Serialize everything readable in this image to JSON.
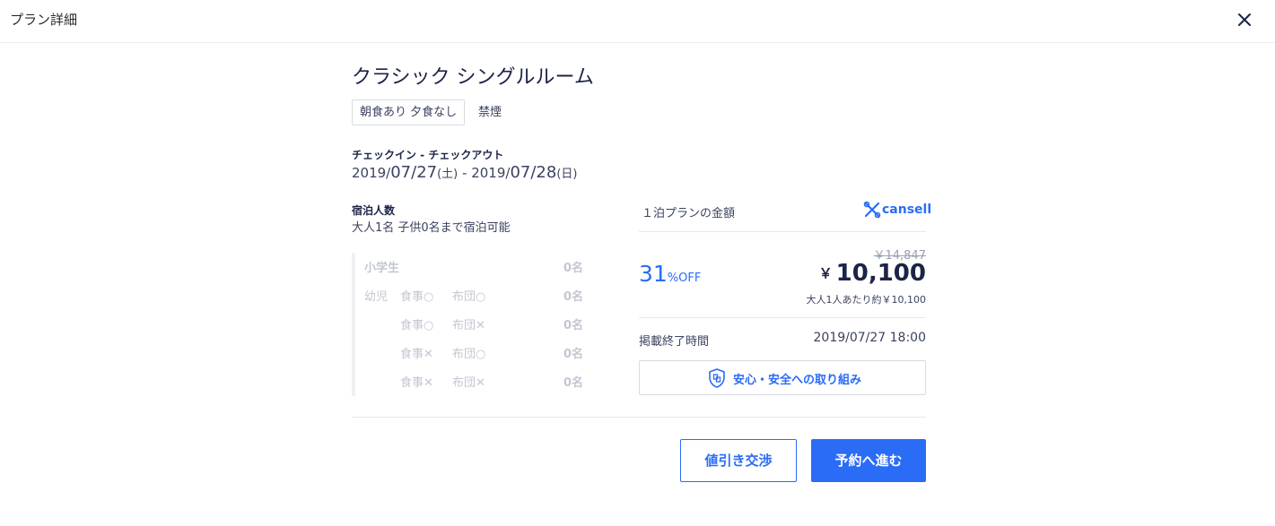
{
  "header": {
    "title": "プラン詳細",
    "close_icon": "close-icon"
  },
  "room": {
    "name": "クラシック シングルルーム",
    "meal_tag": "朝食あり 夕食なし",
    "smoking_tag": "禁煙"
  },
  "stay": {
    "label": "チェックイン - チェックアウト",
    "checkin": {
      "year": "2019/",
      "date": "07/27",
      "day": "(土)"
    },
    "separator": " - ",
    "checkout": {
      "year": "2019/",
      "date": "07/28",
      "day": "(日)"
    }
  },
  "guests": {
    "label": "宿泊人数",
    "text": "大人1名 子供0名まで宿泊可能"
  },
  "children": [
    {
      "label": "小学生",
      "food": "",
      "bed": "",
      "count": "0名"
    },
    {
      "label": "幼児",
      "food": "食事",
      "food_mark": "○",
      "bed": "布団",
      "bed_mark": "○",
      "count": "0名"
    },
    {
      "label": "",
      "food": "食事",
      "food_mark": "○",
      "bed": "布団",
      "bed_mark": "✕",
      "count": "0名"
    },
    {
      "label": "",
      "food": "食事",
      "food_mark": "✕",
      "bed": "布団",
      "bed_mark": "○",
      "count": "0名"
    },
    {
      "label": "",
      "food": "食事",
      "food_mark": "✕",
      "bed": "布団",
      "bed_mark": "✕",
      "count": "0名"
    }
  ],
  "price": {
    "title": "１泊プランの金額",
    "brand": "cansell",
    "brand_icon": "cansell-logo-icon",
    "discount_num": "31",
    "discount_unit": "%OFF",
    "original": "￥14,847",
    "currency": "￥",
    "amount": "10,100",
    "per_adult": "大人1人あたり約￥10,100",
    "deadline_label": "掲載終了時間",
    "deadline_value": "2019/07/27 18:00"
  },
  "safety": {
    "icon": "shield-icon",
    "label": "安心・安全への取り組み"
  },
  "actions": {
    "negotiate": "値引き交渉",
    "reserve": "予約へ進む"
  },
  "colors": {
    "accent": "#2a6cf6",
    "text_dark": "#1c2447",
    "muted": "#c3c7d1"
  }
}
